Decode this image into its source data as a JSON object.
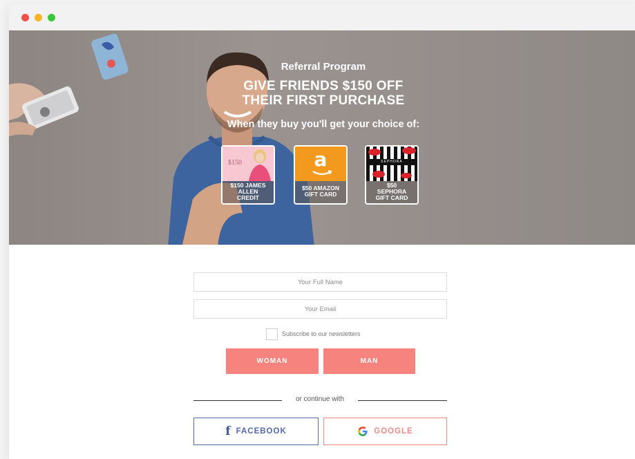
{
  "window": {
    "controls": [
      "close",
      "minimize",
      "maximize"
    ]
  },
  "hero": {
    "kicker": "Referral Program",
    "title_line1": "GIVE FRIENDS $150 OFF",
    "title_line2": "THEIR FIRST PURCHASE",
    "subtitle": "When they buy you'll get your choice of:",
    "cards": [
      {
        "image_text": "$150",
        "label_line1": "$150 JAMES",
        "label_line2": "ALLEN",
        "label_line3": "CREDIT"
      },
      {
        "image_text": "a",
        "label_line1": "$50 AMAZON",
        "label_line2": "GIFT CARD",
        "label_line3": ""
      },
      {
        "image_text": "SEPHORA",
        "label_line1": "$50",
        "label_line2": "SEPHORA",
        "label_line3": "GIFT CARD"
      }
    ]
  },
  "form": {
    "name_placeholder": "Your Full Name",
    "email_placeholder": "Your Email",
    "subscribe_label": "Subscribe to our newsletters",
    "woman_label": "WOMAN",
    "man_label": "MAN",
    "divider_text": "or continue with",
    "facebook_label": "FACEBOOK",
    "google_label": "GOOGLE"
  },
  "colors": {
    "accent": "#f7837f",
    "facebook": "#5467a8",
    "google": "#f08a86",
    "hero_bg": "#948c89"
  },
  "icons": [
    "facebook-f-icon",
    "google-g-icon",
    "amazon-logo-icon"
  ]
}
